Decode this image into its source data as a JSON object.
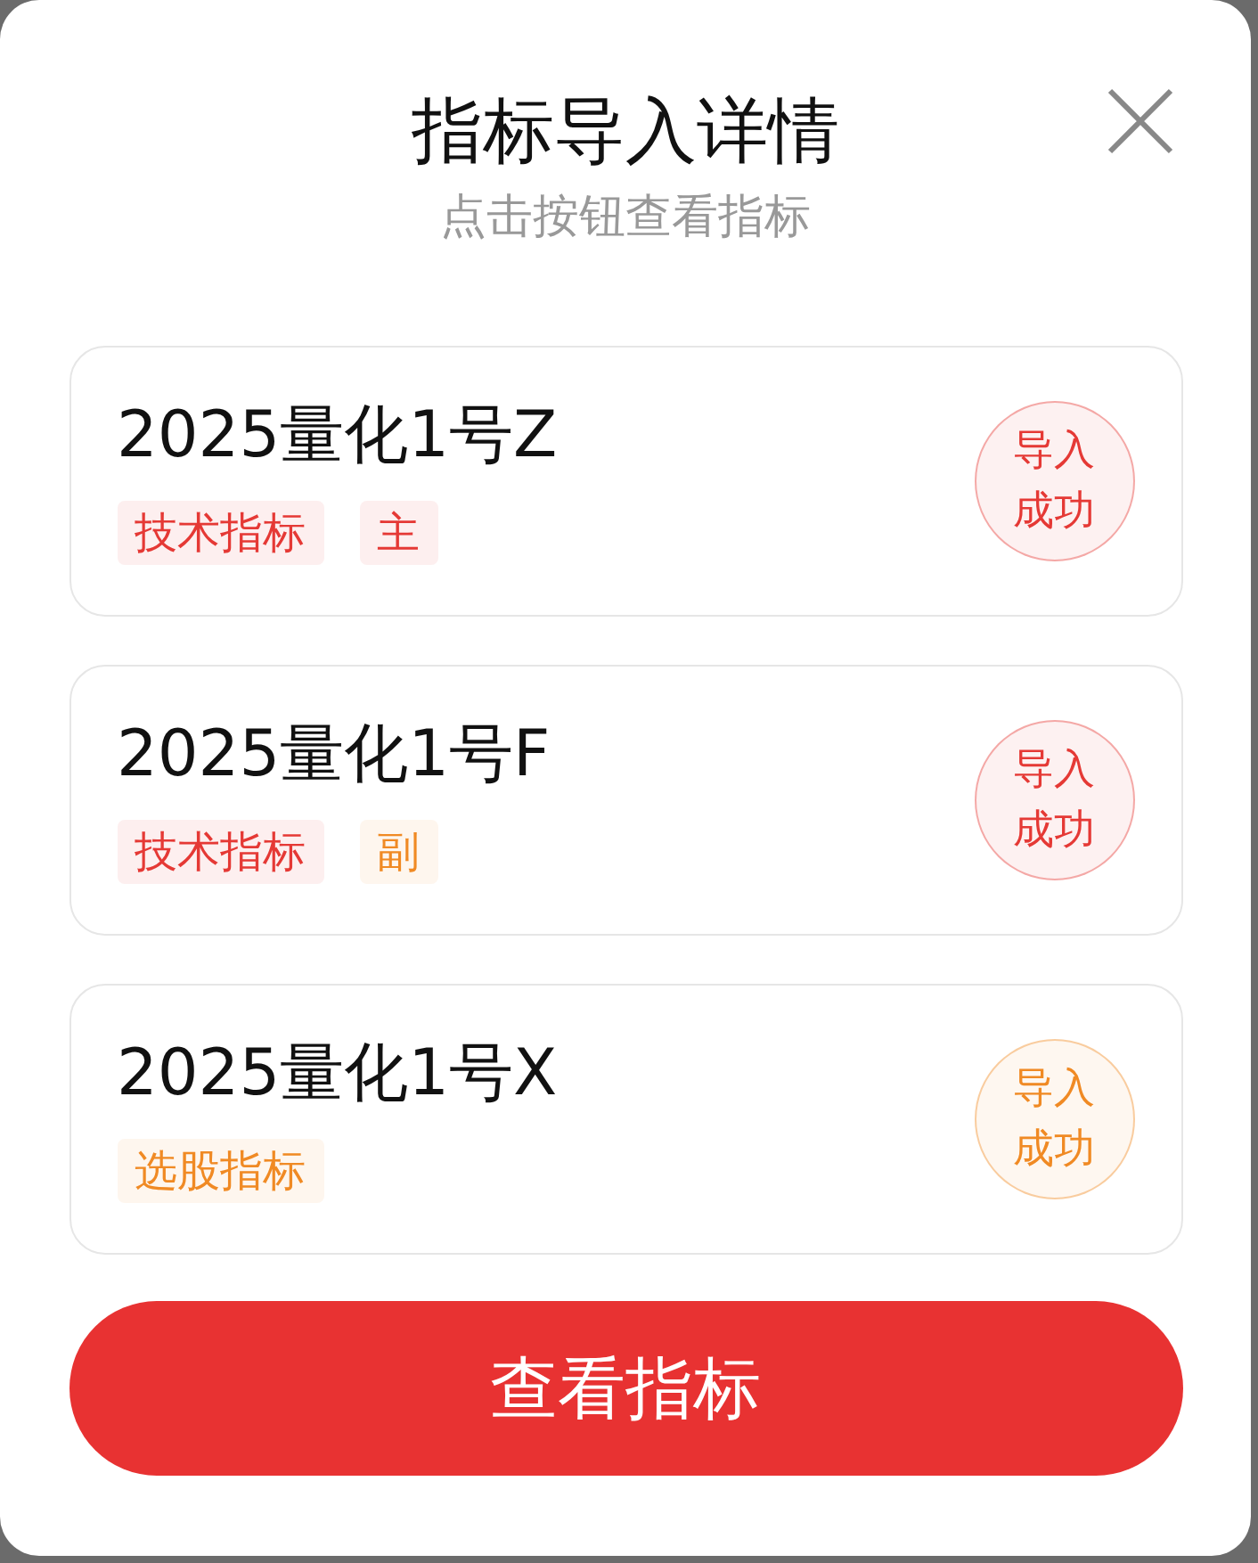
{
  "dialog": {
    "title": "指标导入详情",
    "subtitle": "点击按钮查看指标"
  },
  "cards": [
    {
      "name": "2025量化1号Z",
      "tags": [
        {
          "label": "技术指标",
          "color": "#e53935"
        },
        {
          "label": "主",
          "color": "#e53935"
        }
      ],
      "status": {
        "text": "导入成功",
        "color": "#e53935"
      }
    },
    {
      "name": "2025量化1号F",
      "tags": [
        {
          "label": "技术指标",
          "color": "#e53935"
        },
        {
          "label": "副",
          "color": "#f08a24"
        }
      ],
      "status": {
        "text": "导入成功",
        "color": "#e53935"
      }
    },
    {
      "name": "2025量化1号X",
      "tags": [
        {
          "label": "选股指标",
          "color": "#f08a24"
        }
      ],
      "status": {
        "text": "导入成功",
        "color": "#f08a24"
      }
    }
  ],
  "primary_button": "查看指标"
}
